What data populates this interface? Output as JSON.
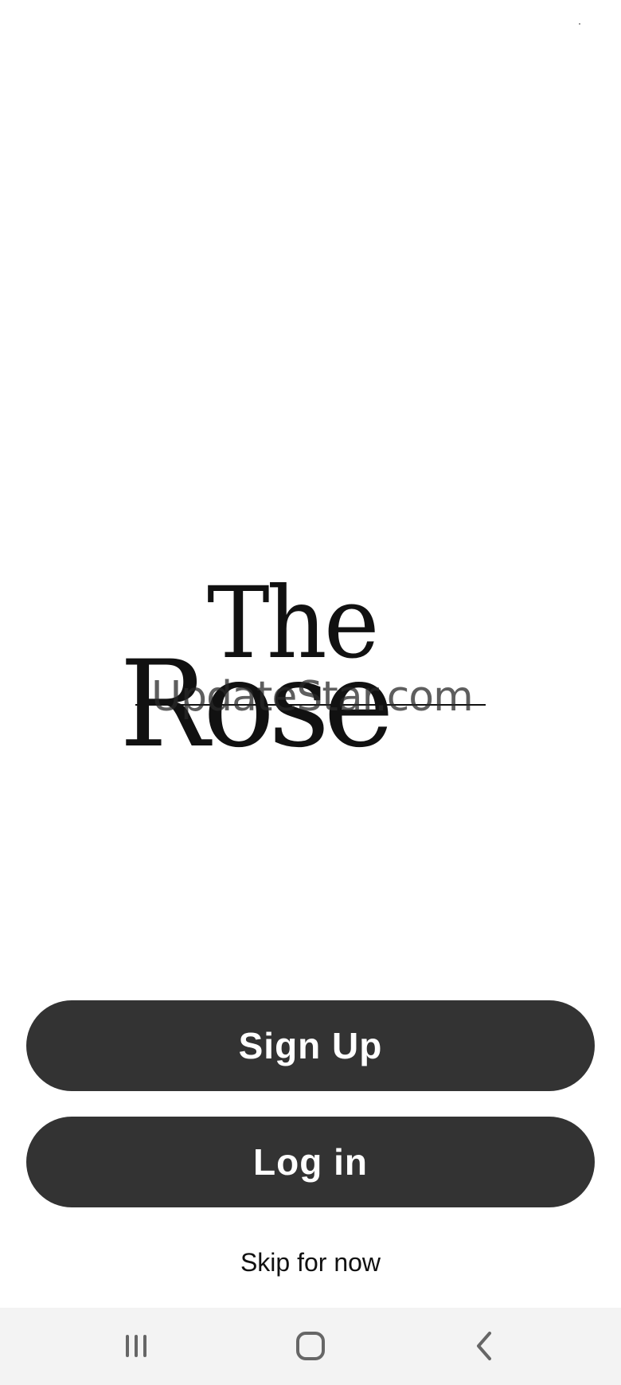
{
  "brand": {
    "logo_line1": "The",
    "logo_line2": "Rose",
    "watermark": "UpdateStar.com"
  },
  "actions": {
    "signup_label": "Sign Up",
    "login_label": "Log in",
    "skip_label": "Skip for now"
  },
  "navbar": {
    "recent": "recent-apps-icon",
    "home": "home-icon",
    "back": "back-icon"
  },
  "colors": {
    "button_bg": "#333333",
    "button_text": "#ffffff",
    "navbar_bg": "#f3f3f3"
  }
}
